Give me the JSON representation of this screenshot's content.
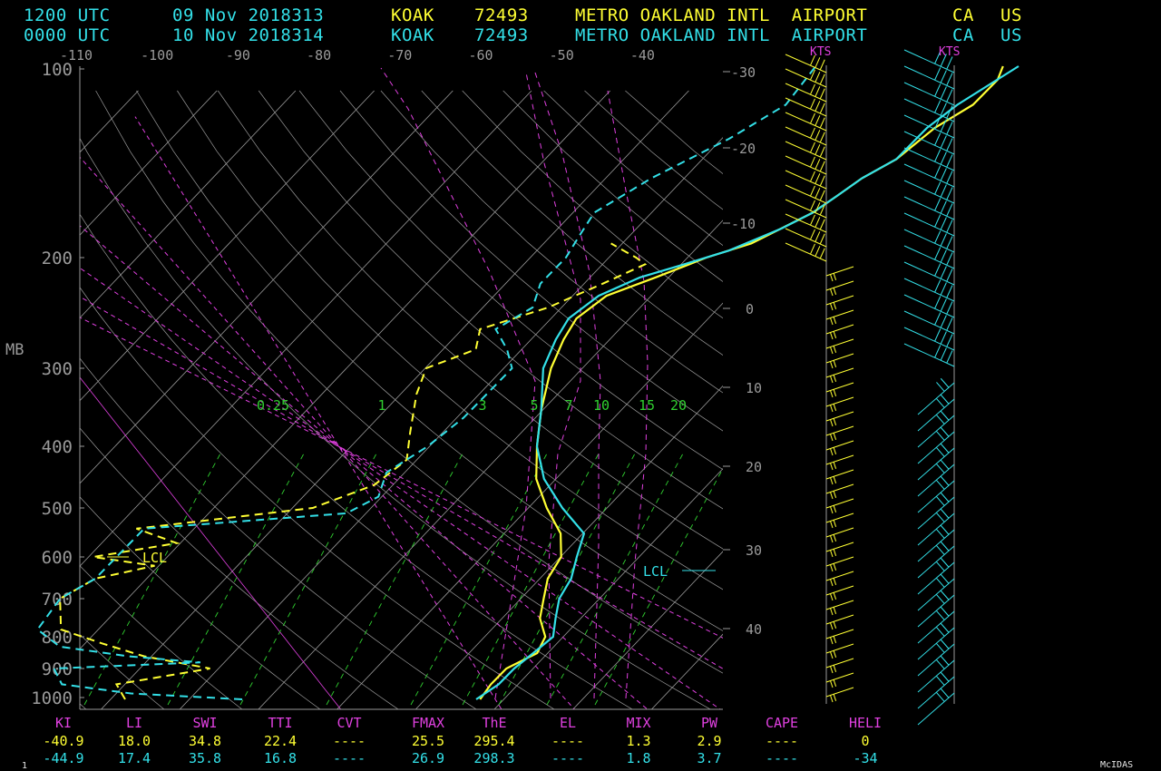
{
  "colors": {
    "yellow": "#ffff33",
    "cyan": "#33e0e8",
    "magenta": "#e040e0",
    "green": "#30d030",
    "white": "#e8e8e8",
    "gray": "#9a9a9a",
    "bg": "#000000"
  },
  "header": {
    "rows": [
      {
        "time": "1200 UTC",
        "date": "09 Nov 2018313",
        "station": "KOAK",
        "id": "72493",
        "name": "METRO OAKLAND INTL  AIRPORT",
        "state": "CA",
        "country": "US"
      },
      {
        "time": "0000 UTC",
        "date": "10 Nov 2018314",
        "station": "KOAK",
        "id": "72493",
        "name": "METRO OAKLAND INTL  AIRPORT",
        "state": "CA",
        "country": "US"
      }
    ]
  },
  "kts_label": "KTS",
  "lcl_label": "LCL",
  "footer": {
    "headers": [
      "KI",
      "LI",
      "SWI",
      "TTI",
      "CVT",
      "FMAX",
      "ThE",
      "EL",
      "MIX",
      "PW",
      "CAPE",
      "HELI"
    ],
    "row1": [
      "-40.9",
      "18.0",
      "34.8",
      "22.4",
      "----",
      "25.5",
      "295.4",
      "----",
      "1.3",
      "2.9",
      "----",
      "0"
    ],
    "row2": [
      "-44.9",
      "17.4",
      "35.8",
      "16.8",
      "----",
      "26.9",
      "298.3",
      "----",
      "1.8",
      "3.7",
      "----",
      "-34"
    ]
  },
  "brand": "McIDAS",
  "page_no": "1",
  "chart_data": {
    "type": "line",
    "subtype": "skew-T log-P sounding",
    "ylabel": "MB",
    "y_scale": "log pressure",
    "y_ticks": [
      100,
      200,
      300,
      400,
      500,
      600,
      700,
      800,
      900,
      1000
    ],
    "x_ticks_top": [
      -110,
      -100,
      -90,
      -80,
      -70,
      -60,
      -50,
      -40
    ],
    "right_ticks": [
      -30,
      -20,
      -10,
      0,
      10,
      20,
      30,
      40
    ],
    "mixing_ratio_labels": [
      "0.25",
      "1",
      "3",
      "5",
      "7",
      "10",
      "15",
      "20"
    ],
    "series": [
      {
        "color": "yellow",
        "kind": "temperature",
        "points": [
          [
            1000,
            -59.5
          ],
          [
            950,
            -60
          ],
          [
            900,
            -60
          ],
          [
            850,
            -58
          ],
          [
            800,
            -59
          ],
          [
            750,
            -62
          ],
          [
            700,
            -64
          ],
          [
            650,
            -66
          ],
          [
            600,
            -67
          ],
          [
            550,
            -70
          ],
          [
            500,
            -75
          ],
          [
            450,
            -80
          ],
          [
            400,
            -84
          ],
          [
            350,
            -88
          ],
          [
            300,
            -92
          ],
          [
            270,
            -94
          ],
          [
            250,
            -95
          ],
          [
            230,
            -94
          ],
          [
            215,
            -90
          ],
          [
            200,
            -86
          ],
          [
            190,
            -82
          ],
          [
            170,
            -78
          ],
          [
            160,
            -77
          ],
          [
            150,
            -76
          ],
          [
            140,
            -74
          ],
          [
            125,
            -73
          ],
          [
            115,
            -71
          ],
          [
            105,
            -71
          ],
          [
            100,
            -72
          ]
        ]
      },
      {
        "color": "yellow",
        "kind": "dewpoint",
        "points": [
          [
            1000,
            -105
          ],
          [
            950,
            -108
          ],
          [
            900,
            -98
          ],
          [
            860,
            -108
          ],
          [
            820,
            -115
          ],
          [
            780,
            -122
          ],
          [
            700,
            -126
          ],
          [
            650,
            -124
          ],
          [
            620,
            -118
          ],
          [
            600,
            -127
          ],
          [
            570,
            -118
          ],
          [
            540,
            -125
          ],
          [
            500,
            -105
          ],
          [
            460,
            -100
          ],
          [
            420,
            -99
          ],
          [
            380,
            -102
          ],
          [
            330,
            -106
          ],
          [
            300,
            -108
          ],
          [
            280,
            -104
          ],
          [
            260,
            -106
          ],
          [
            240,
            -100
          ],
          [
            220,
            -96
          ],
          [
            205,
            -93
          ],
          [
            200,
            -95
          ],
          [
            190,
            -100
          ]
        ]
      },
      {
        "color": "cyan",
        "kind": "temperature",
        "points": [
          [
            1000,
            -60
          ],
          [
            950,
            -59
          ],
          [
            900,
            -59
          ],
          [
            850,
            -58.5
          ],
          [
            800,
            -58
          ],
          [
            750,
            -60
          ],
          [
            700,
            -62
          ],
          [
            650,
            -63
          ],
          [
            600,
            -65
          ],
          [
            550,
            -67
          ],
          [
            500,
            -73
          ],
          [
            450,
            -79
          ],
          [
            400,
            -84
          ],
          [
            350,
            -88
          ],
          [
            300,
            -93
          ],
          [
            270,
            -95
          ],
          [
            250,
            -96
          ],
          [
            230,
            -95
          ],
          [
            215,
            -92
          ],
          [
            205,
            -88
          ],
          [
            195,
            -84
          ],
          [
            180,
            -80
          ],
          [
            170,
            -78
          ],
          [
            160,
            -77
          ],
          [
            150,
            -76
          ],
          [
            140,
            -74
          ],
          [
            125,
            -74
          ],
          [
            115,
            -73
          ],
          [
            100,
            -70
          ]
        ]
      },
      {
        "color": "cyan",
        "kind": "dewpoint",
        "points": [
          [
            1000,
            -90
          ],
          [
            980,
            -105
          ],
          [
            950,
            -115
          ],
          [
            900,
            -118
          ],
          [
            880,
            -100
          ],
          [
            860,
            -110
          ],
          [
            830,
            -120
          ],
          [
            780,
            -125
          ],
          [
            700,
            -126
          ],
          [
            650,
            -124
          ],
          [
            540,
            -124
          ],
          [
            510,
            -100
          ],
          [
            480,
            -98
          ],
          [
            440,
            -100
          ],
          [
            400,
            -98
          ],
          [
            360,
            -97
          ],
          [
            330,
            -97
          ],
          [
            300,
            -97
          ],
          [
            280,
            -100
          ],
          [
            260,
            -104
          ],
          [
            240,
            -102
          ],
          [
            220,
            -104
          ],
          [
            200,
            -104
          ],
          [
            185,
            -105
          ],
          [
            170,
            -106
          ],
          [
            150,
            -103
          ],
          [
            130,
            -98
          ],
          [
            115,
            -95
          ],
          [
            100,
            -96
          ]
        ]
      }
    ]
  }
}
